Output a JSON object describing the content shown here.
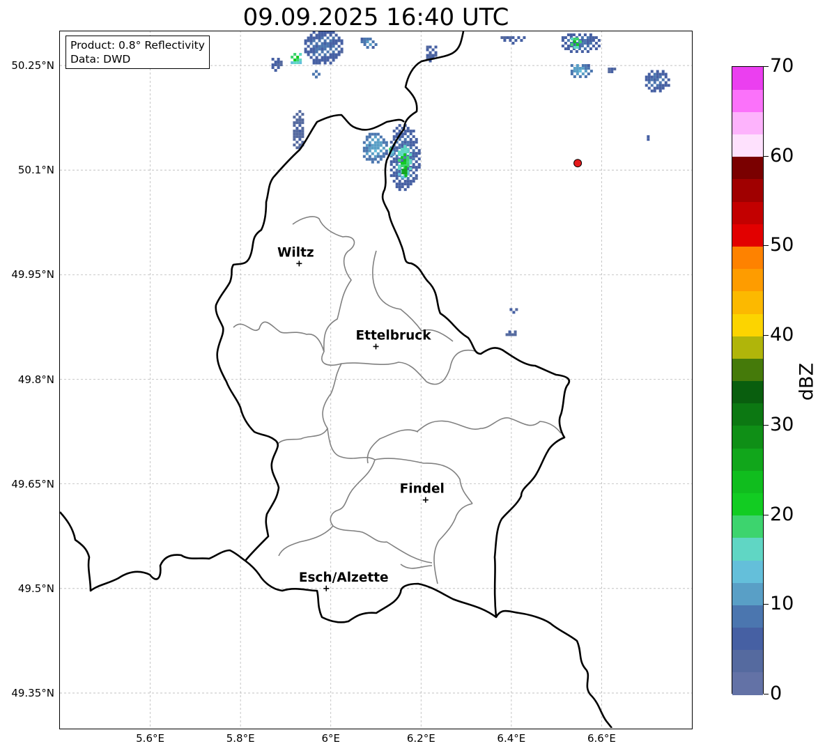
{
  "title": "09.09.2025 16:40 UTC",
  "info_box": {
    "product": "Product: 0.8° Reflectivity",
    "data_source": "Data: DWD"
  },
  "axes": {
    "lon_min": 5.4,
    "lon_max": 6.8,
    "lat_min": 49.3,
    "lat_max": 50.3,
    "lat_ticks": [
      "50.25°N",
      "50.1°N",
      "49.95°N",
      "49.8°N",
      "49.65°N",
      "49.5°N",
      "49.35°N"
    ],
    "lon_ticks": [
      "5.6°E",
      "5.8°E",
      "6°E",
      "6.2°E",
      "6.4°E",
      "6.6°E"
    ],
    "grid": true
  },
  "cities": [
    {
      "name": "Wiltz",
      "lon": 5.93,
      "lat": 49.966
    },
    {
      "name": "Ettelbruck",
      "lon": 6.1,
      "lat": 49.847
    },
    {
      "name": "Findel",
      "lon": 6.21,
      "lat": 49.627
    },
    {
      "name": "Esch/Alzette",
      "lon": 5.99,
      "lat": 49.5
    }
  ],
  "radar_site": {
    "lon": 6.547,
    "lat": 50.11,
    "color": "#e41a1c"
  },
  "colorbar": {
    "label": "dBZ",
    "min": 0,
    "max": 70,
    "tick_labels": [
      "0",
      "10",
      "20",
      "30",
      "40",
      "50",
      "60",
      "70"
    ],
    "colors": [
      "#6372a6",
      "#556a9f",
      "#4660a3",
      "#4b76af",
      "#599fc6",
      "#64bfda",
      "#60d6c4",
      "#3dd46e",
      "#12cc22",
      "#10bd1e",
      "#11a61b",
      "#0f8f16",
      "#0c7812",
      "#095e0e",
      "#457a0a",
      "#b0b50a",
      "#fcd400",
      "#fcb900",
      "#fe9c00",
      "#fe8200",
      "#e20000",
      "#c30000",
      "#a00000",
      "#7a0000",
      "#fee1fd",
      "#fdb3fc",
      "#fb72fa",
      "#eb3ff0"
    ]
  },
  "echoes": [
    {
      "lon": 5.98,
      "lat": 50.28,
      "w": 0.09,
      "h": 0.055,
      "dbz": 8
    },
    {
      "lon": 5.92,
      "lat": 50.262,
      "w": 0.03,
      "h": 0.02,
      "dbz": 22
    },
    {
      "lon": 5.875,
      "lat": 50.255,
      "w": 0.025,
      "h": 0.02,
      "dbz": 6
    },
    {
      "lon": 5.965,
      "lat": 50.24,
      "w": 0.025,
      "h": 0.015,
      "dbz": 10
    },
    {
      "lon": 6.08,
      "lat": 50.285,
      "w": 0.04,
      "h": 0.018,
      "dbz": 10
    },
    {
      "lon": 6.22,
      "lat": 50.27,
      "w": 0.03,
      "h": 0.025,
      "dbz": 6
    },
    {
      "lon": 5.925,
      "lat": 50.16,
      "w": 0.03,
      "h": 0.06,
      "dbz": 4
    },
    {
      "lon": 6.095,
      "lat": 50.135,
      "w": 0.06,
      "h": 0.045,
      "dbz": 12
    },
    {
      "lon": 6.16,
      "lat": 50.12,
      "w": 0.07,
      "h": 0.1,
      "dbz": 8
    },
    {
      "lon": 6.16,
      "lat": 50.115,
      "w": 0.035,
      "h": 0.05,
      "dbz": 22
    },
    {
      "lon": 6.16,
      "lat": 50.1,
      "w": 0.018,
      "h": 0.02,
      "dbz": 31
    },
    {
      "lon": 6.13,
      "lat": 50.13,
      "w": 0.015,
      "h": 0.02,
      "dbz": 18
    },
    {
      "lon": 6.55,
      "lat": 50.285,
      "w": 0.09,
      "h": 0.03,
      "dbz": 8
    },
    {
      "lon": 6.54,
      "lat": 50.285,
      "w": 0.03,
      "h": 0.018,
      "dbz": 24
    },
    {
      "lon": 6.55,
      "lat": 50.245,
      "w": 0.05,
      "h": 0.022,
      "dbz": 12
    },
    {
      "lon": 6.72,
      "lat": 50.23,
      "w": 0.06,
      "h": 0.035,
      "dbz": 8
    },
    {
      "lon": 6.62,
      "lat": 50.245,
      "w": 0.025,
      "h": 0.012,
      "dbz": 5
    },
    {
      "lon": 6.4,
      "lat": 49.9,
      "w": 0.02,
      "h": 0.012,
      "dbz": 4
    },
    {
      "lon": 6.395,
      "lat": 49.868,
      "w": 0.028,
      "h": 0.012,
      "dbz": 4
    },
    {
      "lon": 6.4,
      "lat": 50.29,
      "w": 0.06,
      "h": 0.012,
      "dbz": 6
    },
    {
      "lon": 6.7,
      "lat": 50.15,
      "w": 0.012,
      "h": 0.008,
      "dbz": 6
    }
  ]
}
